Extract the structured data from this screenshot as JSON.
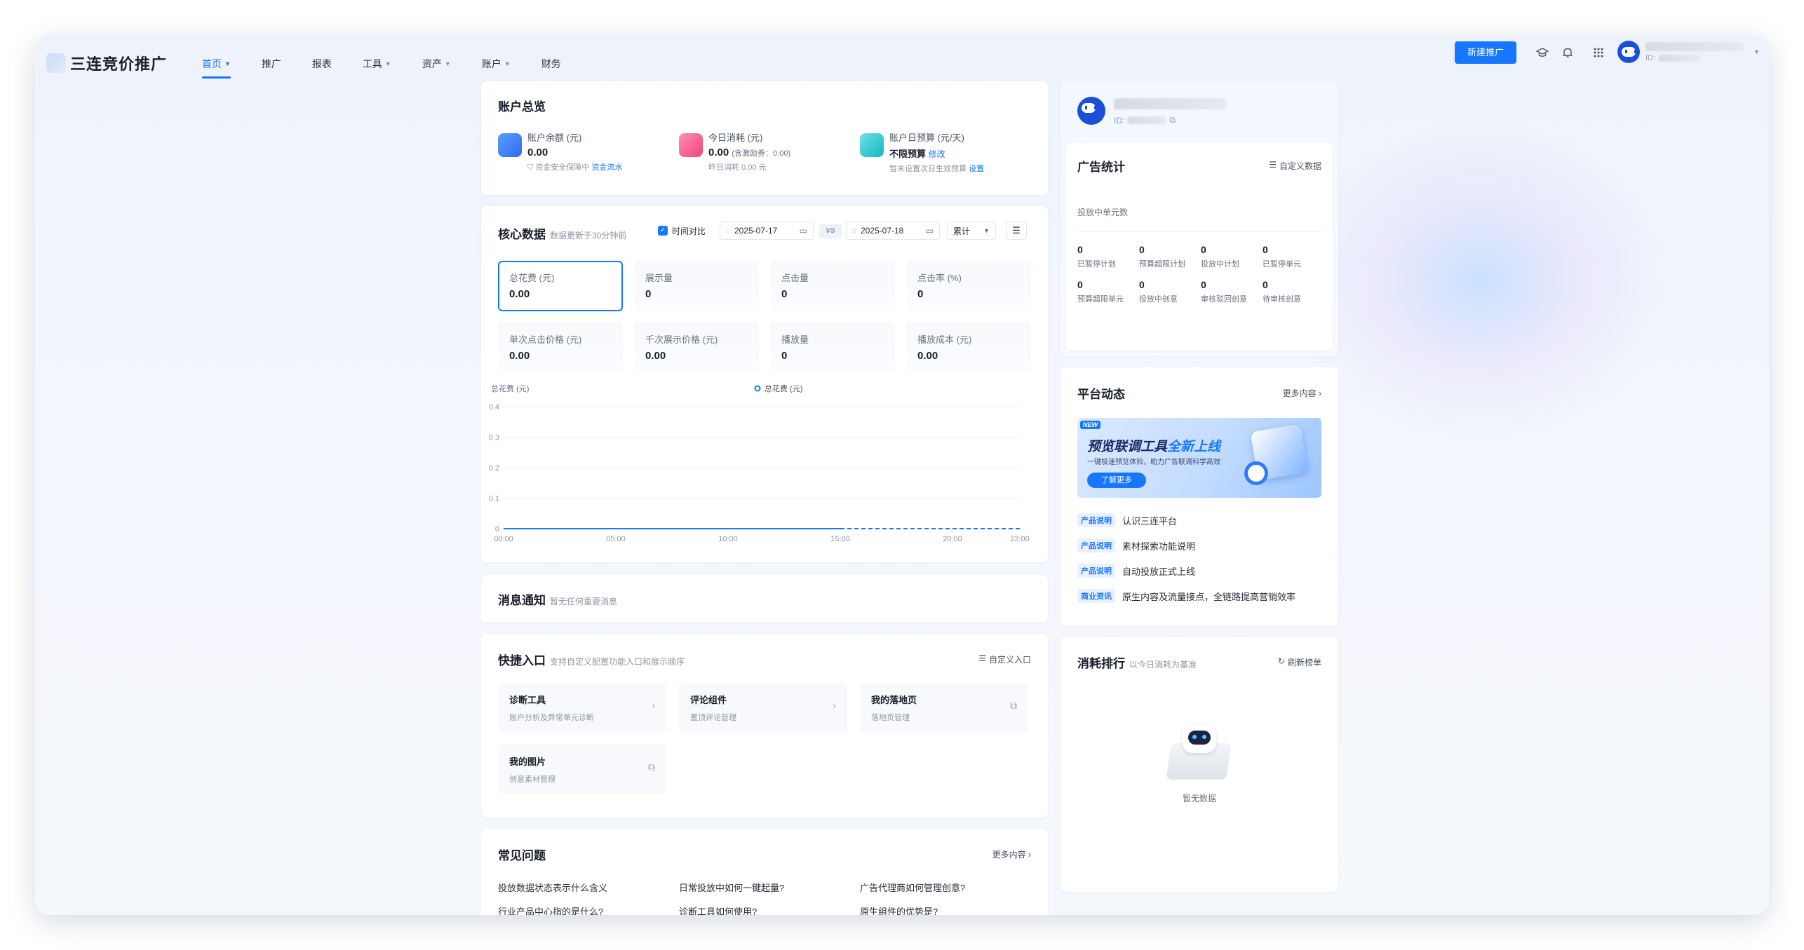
{
  "brand": {
    "name": "三连竞价推广"
  },
  "nav": {
    "items": [
      {
        "label": "首页",
        "dropdown": true,
        "active": true
      },
      {
        "label": "推广",
        "dropdown": false
      },
      {
        "label": "报表",
        "dropdown": false
      },
      {
        "label": "工具",
        "dropdown": true
      },
      {
        "label": "资产",
        "dropdown": true
      },
      {
        "label": "账户",
        "dropdown": true
      },
      {
        "label": "财务",
        "dropdown": false
      }
    ],
    "new_button": "新建推广",
    "user_id_label": "ID:"
  },
  "overview": {
    "title": "账户总览",
    "balance": {
      "label": "账户余额 (元)",
      "value": "0.00",
      "note": "资金安全保障中",
      "link": "资金流水"
    },
    "today": {
      "label": "今日消耗 (元)",
      "value": "0.00",
      "extra": "(含激励券：0.00)",
      "note": "昨日消耗 0.00 元"
    },
    "budget": {
      "label": "账户日预算 (元/天)",
      "value": "不限预算",
      "edit": "修改",
      "note": "暂未设置次日生效预算",
      "link": "设置"
    }
  },
  "core": {
    "title": "核心数据",
    "subtitle": "数据更新于30分钟前",
    "compare": "时间对比",
    "date1": "2025-07-17",
    "vs": "VS",
    "date2": "2025-07-18",
    "mode": "累计",
    "metrics": [
      {
        "label": "总花费 (元)",
        "value": "0.00"
      },
      {
        "label": "展示量",
        "value": "0"
      },
      {
        "label": "点击量",
        "value": "0"
      },
      {
        "label": "点击率 (%)",
        "value": "0"
      },
      {
        "label": "单次点击价格 (元)",
        "value": "0.00"
      },
      {
        "label": "千次展示价格 (元)",
        "value": "0.00"
      },
      {
        "label": "播放量",
        "value": "0"
      },
      {
        "label": "播放成本 (元)",
        "value": "0.00"
      }
    ]
  },
  "chart_data": {
    "type": "line",
    "ylabel": "总花费 (元)",
    "ylim": [
      0,
      0.4
    ],
    "yticks": [
      "0.4",
      "0.3",
      "0.2",
      "0.1",
      "0"
    ],
    "xticks": [
      "00:00",
      "05:00",
      "10:00",
      "15:00",
      "20:00",
      "23:00"
    ],
    "series": [
      {
        "name": "总花费 (元)",
        "color": "#1677ff",
        "solid_until": "15:00",
        "x": [
          "00:00",
          "05:00",
          "10:00",
          "15:00",
          "20:00",
          "23:00"
        ],
        "values": [
          0,
          0,
          0,
          0,
          0,
          0
        ]
      }
    ],
    "legend": "top-center",
    "grid": true
  },
  "notice": {
    "title": "消息通知",
    "subtitle": "暂无任何重要消息"
  },
  "quick": {
    "title": "快捷入口",
    "subtitle": "支持自定义配置功能入口和展示顺序",
    "customize": "自定义入口",
    "items": [
      {
        "title": "诊断工具",
        "desc": "账户分析及异常单元诊断",
        "icon": "chevron-right-icon"
      },
      {
        "title": "评论组件",
        "desc": "置顶评论管理",
        "icon": "chevron-right-icon"
      },
      {
        "title": "我的落地页",
        "desc": "落地页管理",
        "icon": "external-link-icon"
      },
      {
        "title": "我的图片",
        "desc": "创意素材管理",
        "icon": "external-link-icon"
      }
    ]
  },
  "faq": {
    "title": "常见问题",
    "more": "更多内容",
    "items": [
      "投放数据状态表示什么含义",
      "日常投放中如何一键起量?",
      "广告代理商如何管理创意?",
      "行业产品中心指的是什么?",
      "诊断工具如何使用?",
      "原生组件的优势是?"
    ]
  },
  "profile": {
    "id_label": "ID:"
  },
  "stats": {
    "title": "广告统计",
    "customize": "自定义数据",
    "running_units": "投放中单元数",
    "row1": [
      {
        "value": "0",
        "label": "已暂停计划"
      },
      {
        "value": "0",
        "label": "预算超限计划"
      },
      {
        "value": "0",
        "label": "投放中计划"
      },
      {
        "value": "0",
        "label": "已暂停单元"
      }
    ],
    "row2": [
      {
        "value": "0",
        "label": "预算超限单元"
      },
      {
        "value": "0",
        "label": "投放中创意"
      },
      {
        "value": "0",
        "label": "审核驳回创意"
      },
      {
        "value": "0",
        "label": "待审核创意"
      }
    ]
  },
  "platform": {
    "title": "平台动态",
    "more": "更多内容",
    "banner": {
      "badge": "NEW",
      "headline_a": "预览联调工具",
      "headline_b": "全新上线",
      "desc": "一键极速预览体验，助力广告联调科学高效",
      "button": "了解更多"
    },
    "news": [
      {
        "tag": "产品说明",
        "text": "认识三连平台"
      },
      {
        "tag": "产品说明",
        "text": "素材探索功能说明"
      },
      {
        "tag": "产品说明",
        "text": "自动投放正式上线"
      },
      {
        "tag": "商业资讯",
        "text": "原生内容及流量接点，全链路提高营销效率"
      }
    ]
  },
  "ranking": {
    "title": "消耗排行",
    "subtitle": "以今日消耗为基准",
    "refresh": "刷新榜单",
    "empty": "暂无数据"
  },
  "colors": {
    "primary": "#1677ff",
    "text": "#1f2329",
    "muted": "#8f95a0"
  }
}
